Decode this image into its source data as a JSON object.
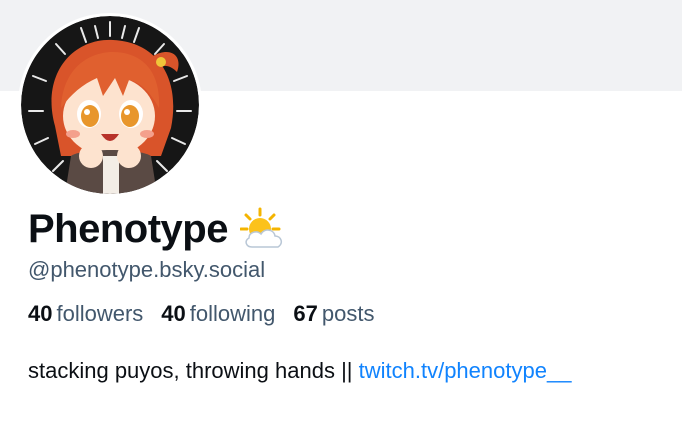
{
  "profile": {
    "display_name": "Phenotype",
    "name_emoji_icon": "sun-behind-cloud-icon",
    "handle": "@phenotype.bsky.social",
    "avatar_icon": "anime-avatar-icon"
  },
  "stats": {
    "followers_count": "40",
    "followers_label": "followers",
    "following_count": "40",
    "following_label": "following",
    "posts_count": "67",
    "posts_label": "posts"
  },
  "bio": {
    "text": "stacking puyos, throwing hands || ",
    "link": "twitch.tv/phenotype__"
  },
  "colors": {
    "banner": "#f1f2f4",
    "muted_text": "#42576c",
    "link": "#1083fe",
    "primary_text": "#0b0f14"
  }
}
